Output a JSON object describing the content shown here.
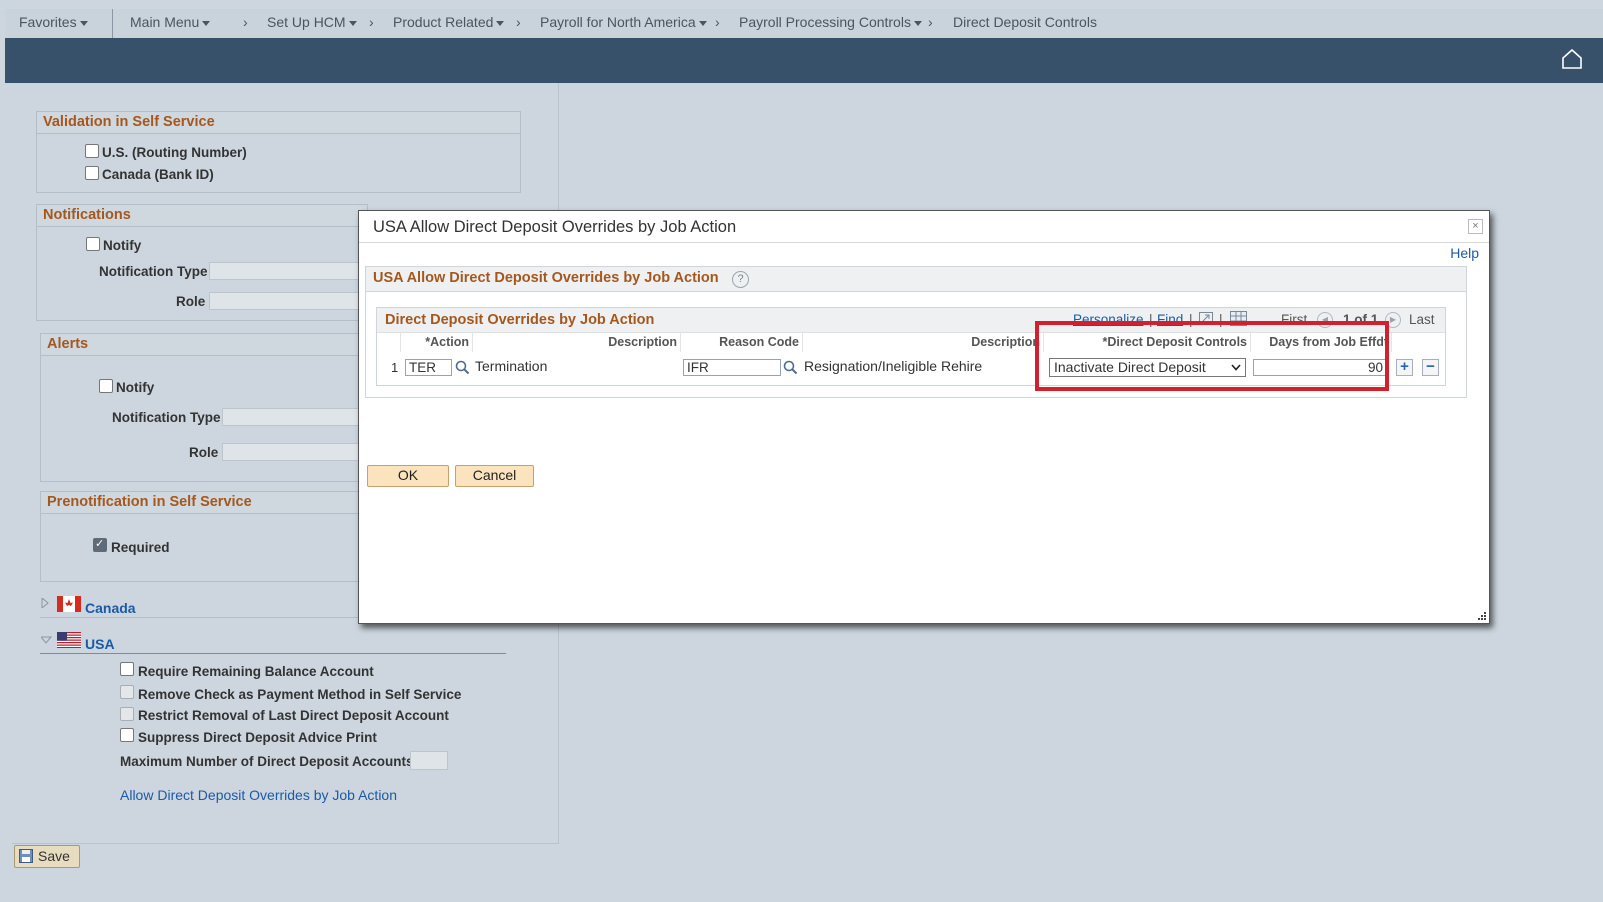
{
  "nav": {
    "favorites": "Favorites",
    "main_menu": "Main Menu",
    "crumbs": [
      "Set Up HCM",
      "Product Related",
      "Payroll for North America",
      "Payroll Processing Controls",
      "Direct Deposit Controls"
    ]
  },
  "validation": {
    "title": "Validation in Self Service",
    "us": "U.S. (Routing Number)",
    "canada": "Canada (Bank ID)"
  },
  "notifications": {
    "title": "Notifications",
    "notify": "Notify",
    "type": "Notification Type",
    "role": "Role"
  },
  "alerts": {
    "title": "Alerts",
    "notify": "Notify",
    "type": "Notification Type",
    "role": "Role"
  },
  "prenote": {
    "title": "Prenotification in Self Service",
    "required": "Required"
  },
  "countries": {
    "canada": "Canada",
    "usa": "USA"
  },
  "usa_options": {
    "require_remaining": "Require Remaining Balance Account",
    "remove_check": "Remove Check as Payment Method in Self Service",
    "restrict_removal": "Restrict Removal of Last Direct Deposit Account",
    "suppress_advice": "Suppress Direct Deposit Advice Print",
    "max_accounts": "Maximum Number of Direct Deposit Accounts",
    "link": "Allow Direct Deposit Overrides by Job Action"
  },
  "save": "Save",
  "modal": {
    "title": "USA Allow Direct Deposit Overrides by Job Action",
    "help": "Help",
    "section_title": "USA Allow Direct Deposit Overrides by Job Action",
    "grid": {
      "title": "Direct Deposit Overrides by Job Action",
      "personalize": "Personalize",
      "find": "Find",
      "first": "First",
      "counter": "1 of 1",
      "last": "Last",
      "headers": {
        "action": "*Action",
        "description": "Description",
        "reason_code": "Reason Code",
        "description2": "Description",
        "dd_controls": "*Direct Deposit Controls",
        "days": "Days from Job Effdt"
      },
      "row": {
        "num": "1",
        "action": "TER",
        "action_desc": "Termination",
        "reason": "IFR",
        "reason_desc": "Resignation/Ineligible Rehire",
        "dd_control": "Inactivate Direct Deposit",
        "days": "90"
      }
    },
    "ok": "OK",
    "cancel": "Cancel"
  },
  "colors": {
    "accent": "#a5581e",
    "banner": "#38516b",
    "link": "#1b5aa6",
    "highlight": "#d2202f"
  }
}
